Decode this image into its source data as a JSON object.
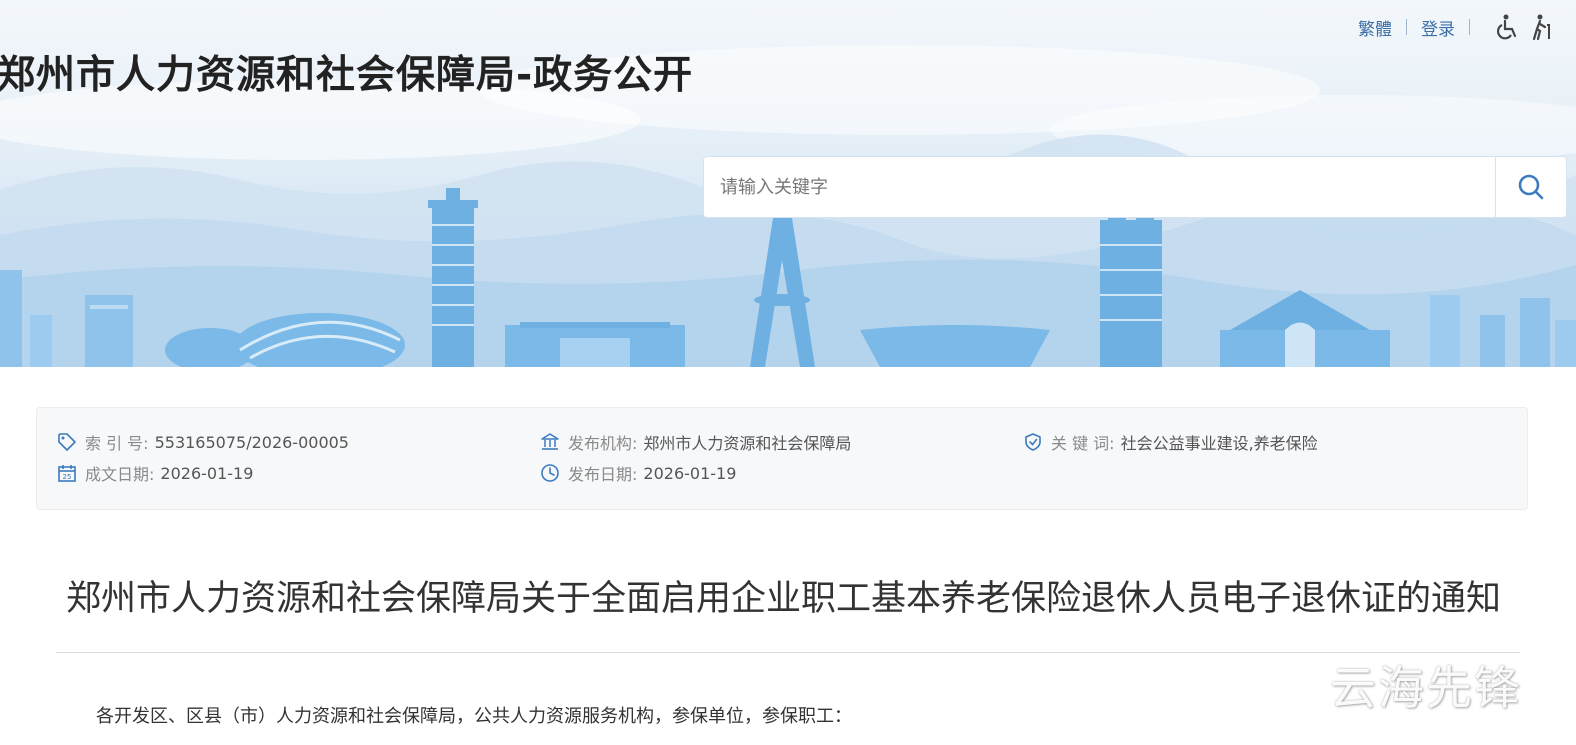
{
  "header": {
    "site_title": "郑州市人力资源和社会保障局-政务公开",
    "links": {
      "traditional": "繁體",
      "login": "登录"
    },
    "icons": [
      "wheelchair-accessibility-icon",
      "elderly-mode-icon"
    ]
  },
  "search": {
    "placeholder": "请输入关键字",
    "value": "",
    "button_icon": "search-icon"
  },
  "meta": {
    "index_label": "索 引 号:",
    "index_value": "553165075/2026-00005",
    "publisher_label": "发布机构:",
    "publisher_value": "郑州市人力资源和社会保障局",
    "keywords_label": "关 键 词:",
    "keywords_value": "社会公益事业建设,养老保险",
    "written_date_label": "成文日期:",
    "written_date_value": "2026-01-19",
    "publish_date_label": "发布日期:",
    "publish_date_value": "2026-01-19",
    "icons": [
      "tag-icon",
      "institution-icon",
      "shield-check-icon",
      "calendar-icon",
      "clock-icon"
    ]
  },
  "article": {
    "title": "郑州市人力资源和社会保障局关于全面启用企业职工基本养老保险退休人员电子退休证的通知",
    "salutation": "各开发区、区县（市）人力资源和社会保障局，公共人力资源服务机构，参保单位，参保职工："
  },
  "watermark": "云海先锋",
  "colors": {
    "link": "#3b6fa8",
    "icon": "#3d7bbf",
    "skyline": "#8fc3ec",
    "title": "#222222"
  }
}
